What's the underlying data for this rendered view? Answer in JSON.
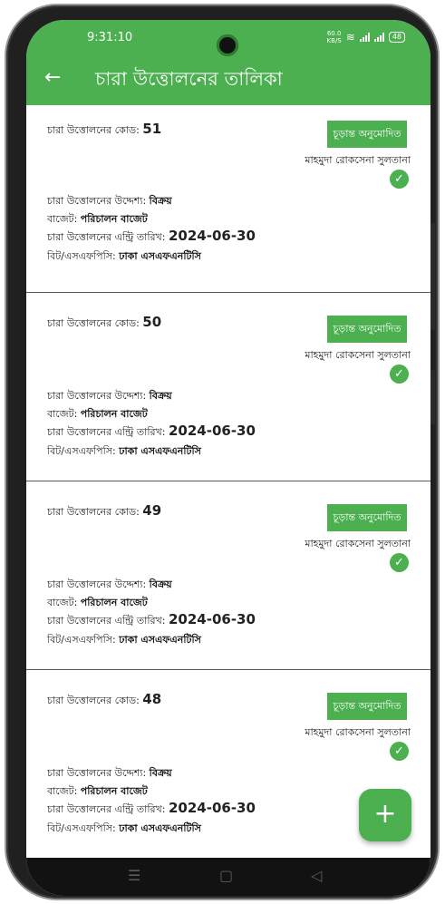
{
  "status_bar": {
    "time": "9:31:10",
    "net_speed_top": "60.0",
    "net_speed_bottom": "KB/S",
    "battery": "48"
  },
  "app_bar": {
    "back_icon": "arrow-left-icon",
    "title": "চারা উত্তোলনের তালিকা"
  },
  "labels": {
    "code": "চারা উত্তোলনের কোড:",
    "purpose": "চারা উত্তোলনের উদ্দেশ্য:",
    "budget": "বাজেট:",
    "entry_date": "চারা উত্তোলনের এন্ট্রি তারিখ:",
    "bit": "বিট/এসএফপিসি:"
  },
  "records": [
    {
      "code": "51",
      "purpose": "বিক্রয়",
      "budget": "পরিচালন বাজেট",
      "entry_date": "2024-06-30",
      "bit": "ঢাকা এসএফএনটিসি",
      "status": "চূড়ান্ত অনুমোদিত",
      "approver": "মাহমুদা রোকসেনা সুলতানা"
    },
    {
      "code": "50",
      "purpose": "বিক্রয়",
      "budget": "পরিচালন বাজেট",
      "entry_date": "2024-06-30",
      "bit": "ঢাকা এসএফএনটিসি",
      "status": "চূড়ান্ত অনুমোদিত",
      "approver": "মাহমুদা রোকসেনা সুলতানা"
    },
    {
      "code": "49",
      "purpose": "বিক্রয়",
      "budget": "পরিচালন বাজেট",
      "entry_date": "2024-06-30",
      "bit": "ঢাকা এসএফএনটিসি",
      "status": "চূড়ান্ত অনুমোদিত",
      "approver": "মাহমুদা রোকসেনা সুলতানা"
    },
    {
      "code": "48",
      "purpose": "বিক্রয়",
      "budget": "পরিচালন বাজেট",
      "entry_date": "2024-06-30",
      "bit": "ঢাকা এসএফএনটিসি",
      "status": "চূড়ান্ত অনুমোদিত",
      "approver": "মাহমুদা রোকসেনা সুলতানা"
    }
  ],
  "fab": {
    "icon": "plus-icon",
    "label": "+"
  },
  "colors": {
    "primary": "#4caf50",
    "navbar": "#121212"
  }
}
